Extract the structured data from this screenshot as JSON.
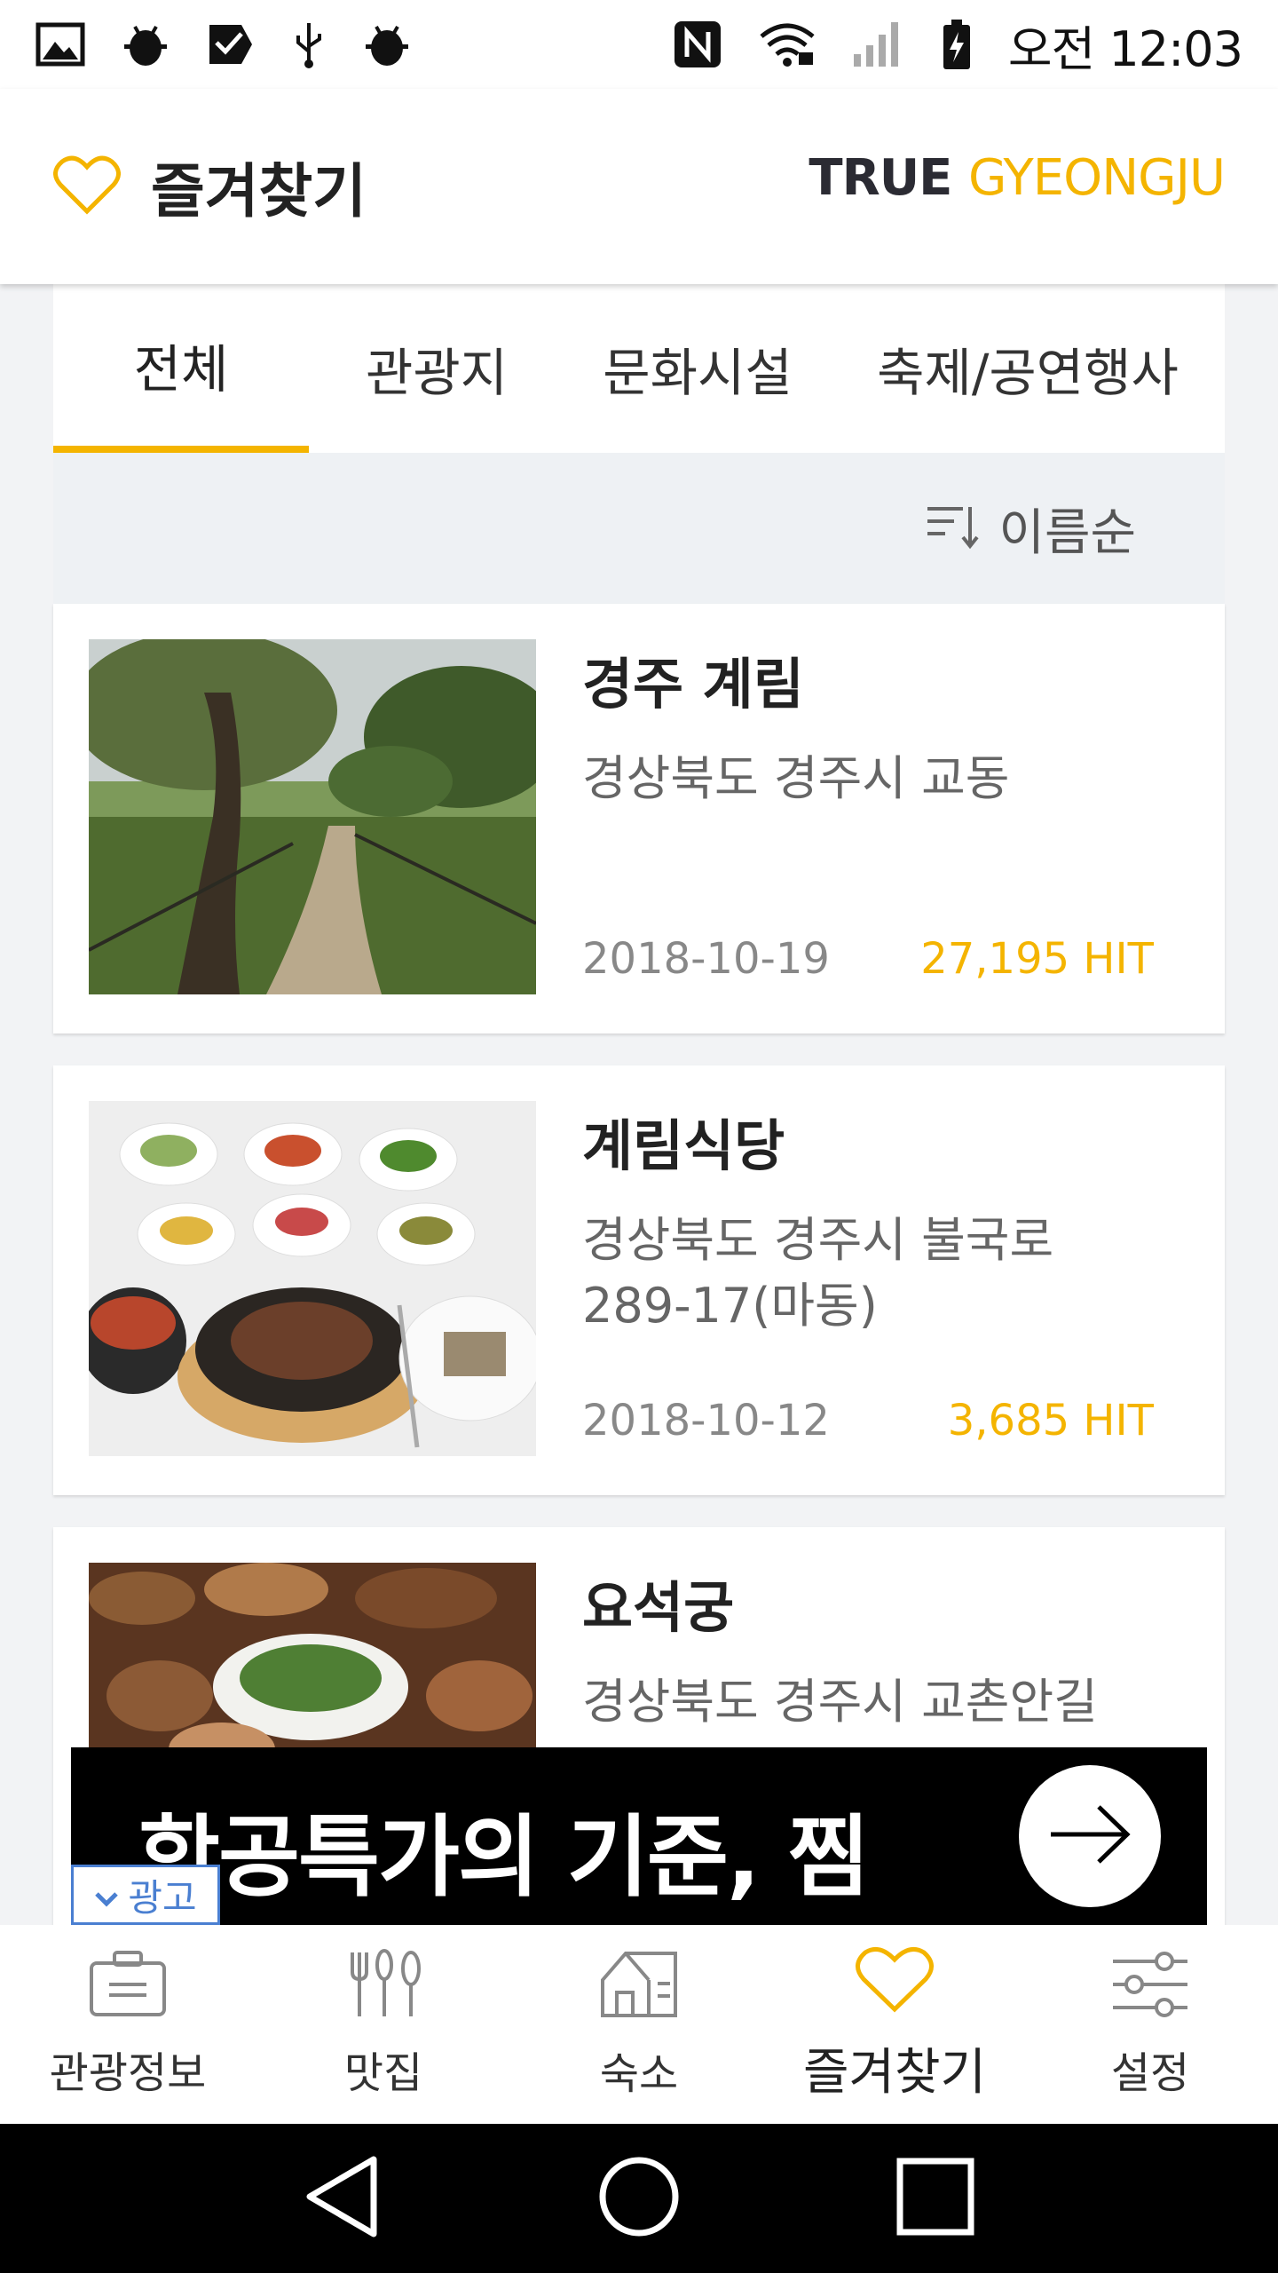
{
  "status_bar": {
    "time": "오전 12:03",
    "left_icons": [
      "gallery-icon",
      "android-debug-icon",
      "task-check-icon",
      "usb-icon",
      "android-debug-icon"
    ],
    "right_icons": [
      "nfc-icon",
      "wifi-icon",
      "signal-icon",
      "battery-icon"
    ]
  },
  "header": {
    "title": "즐겨찾기",
    "brand_true": "TRUE ",
    "brand_place": "GYEONGJU",
    "accent_color": "#f4b400"
  },
  "tabs": [
    {
      "label": "전체",
      "active": true
    },
    {
      "label": "관광지",
      "active": false
    },
    {
      "label": "문화시설",
      "active": false
    },
    {
      "label": "축제/공연행사",
      "active": false
    }
  ],
  "sort": {
    "label": "이름순"
  },
  "items": [
    {
      "name": "경주 계림",
      "address": "경상북도 경주시 교동",
      "date": "2018-10-19",
      "hits": "27,195 HIT",
      "image": "forest-path-photo"
    },
    {
      "name": "계림식당",
      "address": "경상북도 경주시 불국로 289-17(마동)",
      "date": "2018-10-12",
      "hits": "3,685 HIT",
      "image": "korean-set-meal-photo"
    },
    {
      "name": "요석궁",
      "address": "경상북도 경주시 교촌안길",
      "date": "",
      "hits": "",
      "image": "korean-banquet-photo"
    }
  ],
  "ad": {
    "text": "항공특가의 기준, 찜",
    "badge": "광고"
  },
  "bottom_nav": [
    {
      "label": "관광정보",
      "icon": "briefcase-icon",
      "active": false
    },
    {
      "label": "맛집",
      "icon": "utensils-icon",
      "active": false
    },
    {
      "label": "숙소",
      "icon": "house-icon",
      "active": false
    },
    {
      "label": "즐겨찾기",
      "icon": "heart-icon",
      "active": true
    },
    {
      "label": "설정",
      "icon": "sliders-icon",
      "active": false
    }
  ]
}
